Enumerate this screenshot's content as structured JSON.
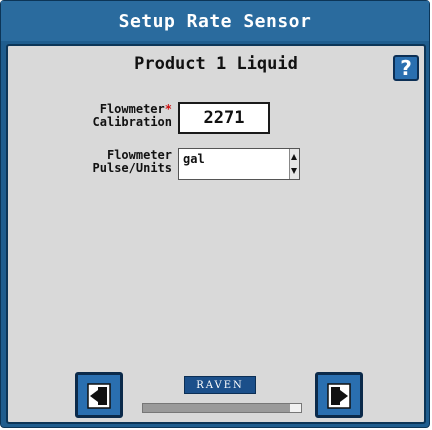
{
  "window": {
    "title": "Setup Rate Sensor"
  },
  "panel": {
    "product_title": "Product 1 Liquid",
    "help_label": "?"
  },
  "fields": {
    "calibration": {
      "label_line1": "Flowmeter",
      "required_mark": "*",
      "label_line2": "Calibration",
      "value": "2271"
    },
    "pulse_units": {
      "label_line1": "Flowmeter",
      "label_line2": "Pulse/Units",
      "value": "gal"
    }
  },
  "footer": {
    "brand": "RAVEN",
    "progress_fraction": 0.93
  },
  "icons": {
    "back": "back-arrow-icon",
    "next": "next-arrow-icon",
    "help": "question-mark-icon"
  },
  "colors": {
    "title_bar": "#2a6b9e",
    "panel": "#d9d9d9",
    "button": "#2a6fb0",
    "required": "#d01010"
  }
}
